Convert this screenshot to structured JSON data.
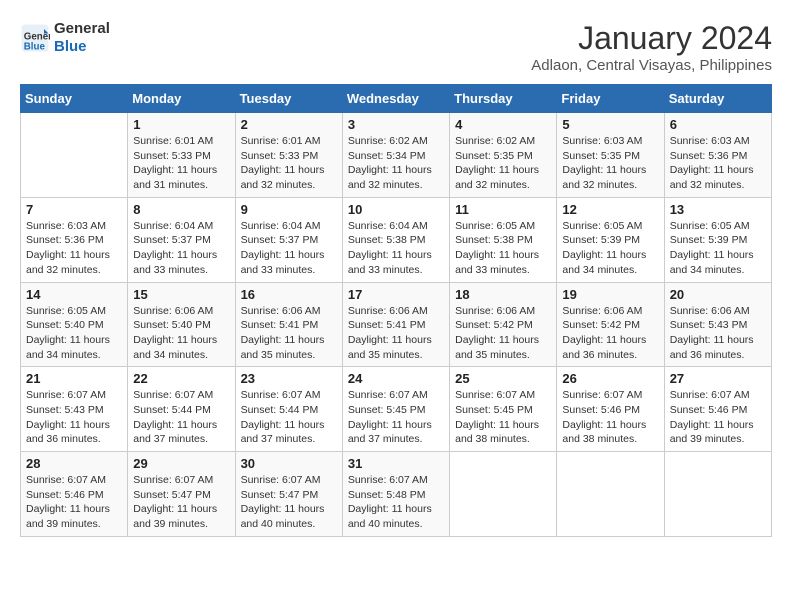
{
  "header": {
    "logo_line1": "General",
    "logo_line2": "Blue",
    "month": "January 2024",
    "location": "Adlaon, Central Visayas, Philippines"
  },
  "weekdays": [
    "Sunday",
    "Monday",
    "Tuesday",
    "Wednesday",
    "Thursday",
    "Friday",
    "Saturday"
  ],
  "weeks": [
    [
      {
        "day": "",
        "sunrise": "",
        "sunset": "",
        "daylight": ""
      },
      {
        "day": "1",
        "sunrise": "6:01 AM",
        "sunset": "5:33 PM",
        "daylight": "11 hours and 31 minutes."
      },
      {
        "day": "2",
        "sunrise": "6:01 AM",
        "sunset": "5:33 PM",
        "daylight": "11 hours and 32 minutes."
      },
      {
        "day": "3",
        "sunrise": "6:02 AM",
        "sunset": "5:34 PM",
        "daylight": "11 hours and 32 minutes."
      },
      {
        "day": "4",
        "sunrise": "6:02 AM",
        "sunset": "5:35 PM",
        "daylight": "11 hours and 32 minutes."
      },
      {
        "day": "5",
        "sunrise": "6:03 AM",
        "sunset": "5:35 PM",
        "daylight": "11 hours and 32 minutes."
      },
      {
        "day": "6",
        "sunrise": "6:03 AM",
        "sunset": "5:36 PM",
        "daylight": "11 hours and 32 minutes."
      }
    ],
    [
      {
        "day": "7",
        "sunrise": "6:03 AM",
        "sunset": "5:36 PM",
        "daylight": "11 hours and 32 minutes."
      },
      {
        "day": "8",
        "sunrise": "6:04 AM",
        "sunset": "5:37 PM",
        "daylight": "11 hours and 33 minutes."
      },
      {
        "day": "9",
        "sunrise": "6:04 AM",
        "sunset": "5:37 PM",
        "daylight": "11 hours and 33 minutes."
      },
      {
        "day": "10",
        "sunrise": "6:04 AM",
        "sunset": "5:38 PM",
        "daylight": "11 hours and 33 minutes."
      },
      {
        "day": "11",
        "sunrise": "6:05 AM",
        "sunset": "5:38 PM",
        "daylight": "11 hours and 33 minutes."
      },
      {
        "day": "12",
        "sunrise": "6:05 AM",
        "sunset": "5:39 PM",
        "daylight": "11 hours and 34 minutes."
      },
      {
        "day": "13",
        "sunrise": "6:05 AM",
        "sunset": "5:39 PM",
        "daylight": "11 hours and 34 minutes."
      }
    ],
    [
      {
        "day": "14",
        "sunrise": "6:05 AM",
        "sunset": "5:40 PM",
        "daylight": "11 hours and 34 minutes."
      },
      {
        "day": "15",
        "sunrise": "6:06 AM",
        "sunset": "5:40 PM",
        "daylight": "11 hours and 34 minutes."
      },
      {
        "day": "16",
        "sunrise": "6:06 AM",
        "sunset": "5:41 PM",
        "daylight": "11 hours and 35 minutes."
      },
      {
        "day": "17",
        "sunrise": "6:06 AM",
        "sunset": "5:41 PM",
        "daylight": "11 hours and 35 minutes."
      },
      {
        "day": "18",
        "sunrise": "6:06 AM",
        "sunset": "5:42 PM",
        "daylight": "11 hours and 35 minutes."
      },
      {
        "day": "19",
        "sunrise": "6:06 AM",
        "sunset": "5:42 PM",
        "daylight": "11 hours and 36 minutes."
      },
      {
        "day": "20",
        "sunrise": "6:06 AM",
        "sunset": "5:43 PM",
        "daylight": "11 hours and 36 minutes."
      }
    ],
    [
      {
        "day": "21",
        "sunrise": "6:07 AM",
        "sunset": "5:43 PM",
        "daylight": "11 hours and 36 minutes."
      },
      {
        "day": "22",
        "sunrise": "6:07 AM",
        "sunset": "5:44 PM",
        "daylight": "11 hours and 37 minutes."
      },
      {
        "day": "23",
        "sunrise": "6:07 AM",
        "sunset": "5:44 PM",
        "daylight": "11 hours and 37 minutes."
      },
      {
        "day": "24",
        "sunrise": "6:07 AM",
        "sunset": "5:45 PM",
        "daylight": "11 hours and 37 minutes."
      },
      {
        "day": "25",
        "sunrise": "6:07 AM",
        "sunset": "5:45 PM",
        "daylight": "11 hours and 38 minutes."
      },
      {
        "day": "26",
        "sunrise": "6:07 AM",
        "sunset": "5:46 PM",
        "daylight": "11 hours and 38 minutes."
      },
      {
        "day": "27",
        "sunrise": "6:07 AM",
        "sunset": "5:46 PM",
        "daylight": "11 hours and 39 minutes."
      }
    ],
    [
      {
        "day": "28",
        "sunrise": "6:07 AM",
        "sunset": "5:46 PM",
        "daylight": "11 hours and 39 minutes."
      },
      {
        "day": "29",
        "sunrise": "6:07 AM",
        "sunset": "5:47 PM",
        "daylight": "11 hours and 39 minutes."
      },
      {
        "day": "30",
        "sunrise": "6:07 AM",
        "sunset": "5:47 PM",
        "daylight": "11 hours and 40 minutes."
      },
      {
        "day": "31",
        "sunrise": "6:07 AM",
        "sunset": "5:48 PM",
        "daylight": "11 hours and 40 minutes."
      },
      {
        "day": "",
        "sunrise": "",
        "sunset": "",
        "daylight": ""
      },
      {
        "day": "",
        "sunrise": "",
        "sunset": "",
        "daylight": ""
      },
      {
        "day": "",
        "sunrise": "",
        "sunset": "",
        "daylight": ""
      }
    ]
  ]
}
